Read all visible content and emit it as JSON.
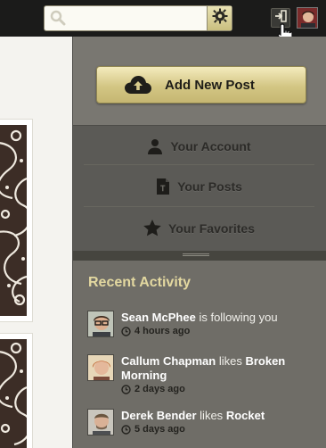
{
  "search": {
    "value": ""
  },
  "icons": {
    "search": "search-icon",
    "settings": "gear-icon",
    "sign_out": "sign-out-icon",
    "add": "cloud-upload-icon",
    "account": "person-icon",
    "posts": "document-icon",
    "favorites": "star-icon",
    "time": "clock-icon"
  },
  "colors": {
    "accent": "#d3c684",
    "heading": "#e3d8a0",
    "panel": "#6f6d67",
    "topbar": "#1b1b1a"
  },
  "panel": {
    "add_button": "Add New Post",
    "menu": [
      {
        "label": "Your Account"
      },
      {
        "label": "Your Posts"
      },
      {
        "label": "Your Favorites"
      }
    ]
  },
  "activity": {
    "title": "Recent Activity",
    "items": [
      {
        "actor": "Sean McPhee",
        "verb": "is following you",
        "object": "",
        "time": "4 hours ago"
      },
      {
        "actor": "Callum Chapman",
        "verb": "likes",
        "object": "Broken Morning",
        "time": "2 days ago"
      },
      {
        "actor": "Derek Bender",
        "verb": "likes",
        "object": "Rocket",
        "time": "5 days ago"
      }
    ]
  }
}
